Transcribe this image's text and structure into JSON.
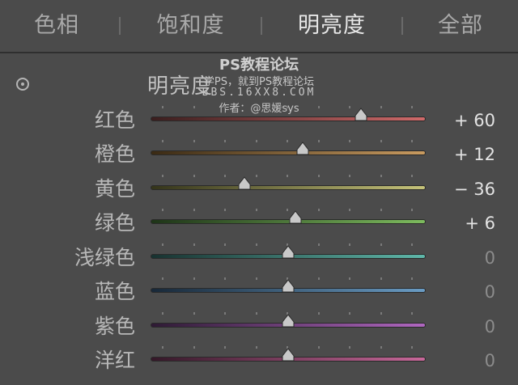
{
  "tabs": [
    {
      "label": "色相",
      "active": false
    },
    {
      "label": "饱和度",
      "active": false
    },
    {
      "label": "明亮度",
      "active": true
    },
    {
      "label": "全部",
      "active": false
    }
  ],
  "watermark": {
    "line1": "PS教程论坛",
    "line2": "学PS，就到PS教程论坛",
    "line3": "BBS.16XX8.COM",
    "line4": "作者：@思媛sys"
  },
  "section": {
    "icon": "target-adjust-icon",
    "title": "明亮度"
  },
  "sliders": [
    {
      "label": "红色",
      "value": 60,
      "display": "+ 60",
      "colors": [
        "#3a1e1e",
        "#d06a6a"
      ]
    },
    {
      "label": "橙色",
      "value": 12,
      "display": "+ 12",
      "colors": [
        "#3a2a14",
        "#c99b60"
      ]
    },
    {
      "label": "黄色",
      "value": -36,
      "display": "− 36",
      "colors": [
        "#34341a",
        "#c6c37a"
      ]
    },
    {
      "label": "绿色",
      "value": 6,
      "display": "+ 6",
      "colors": [
        "#1e3418",
        "#7dbb5e"
      ]
    },
    {
      "label": "浅绿色",
      "value": 0,
      "display": "0",
      "colors": [
        "#183230",
        "#5fb8aa"
      ]
    },
    {
      "label": "蓝色",
      "value": 0,
      "display": "0",
      "colors": [
        "#182838",
        "#6a9cc4"
      ]
    },
    {
      "label": "紫色",
      "value": 0,
      "display": "0",
      "colors": [
        "#2e1a34",
        "#b067c0"
      ]
    },
    {
      "label": "洋红",
      "value": 0,
      "display": "0",
      "colors": [
        "#341828",
        "#c8689a"
      ]
    }
  ],
  "slider_range": [
    -100,
    100
  ]
}
